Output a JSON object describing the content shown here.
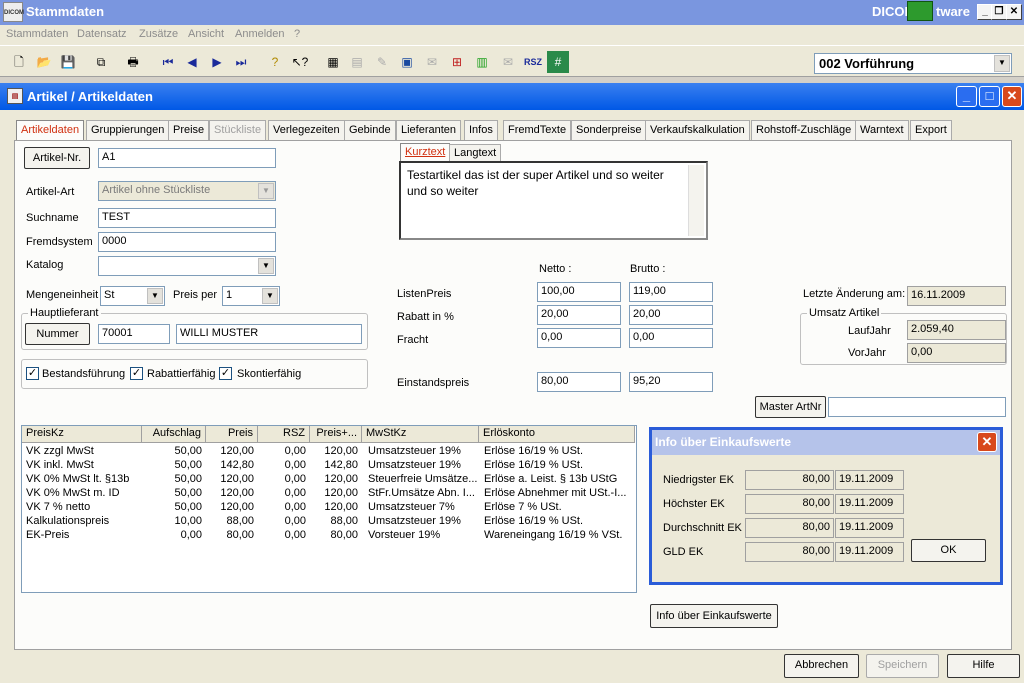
{
  "app": {
    "title": "Stammdaten",
    "brand": "DICOM",
    "brand_tail": "tware",
    "icon_text": "DICOM"
  },
  "menu": [
    "Stammdaten",
    "Datensatz",
    "Zusätze",
    "Ansicht",
    "Anmelden",
    "?"
  ],
  "toolbar": {
    "company_select": "002 Vorführung",
    "rsz_label": "RSZ"
  },
  "window": {
    "title": "Artikel / Artikeldaten"
  },
  "tabs": [
    "Artikeldaten",
    "Gruppierungen",
    "Preise",
    "Stückliste",
    "Verlegezeiten",
    "Gebinde",
    "Lieferanten",
    "Infos",
    "FremdTexte",
    "Sonderpreise",
    "Verkaufskalkulation",
    "Rohstoff-Zuschläge",
    "Warntext",
    "Export"
  ],
  "form": {
    "artikel_nr_button": "Artikel-Nr.",
    "artikel_nr": "A1",
    "artikel_art_label": "Artikel-Art",
    "artikel_art": "Artikel ohne Stückliste",
    "suchname_label": "Suchname",
    "suchname": "TEST",
    "fremdsystem_label": "Fremdsystem",
    "fremdsystem": "0000",
    "katalog_label": "Katalog",
    "katalog": "",
    "mengeneinheit_label": "Mengeneinheit",
    "mengeneinheit": "St",
    "preis_per_label": "Preis per",
    "preis_per": "1",
    "hauptlieferant_label": "Hauptlieferant",
    "nummer_button": "Nummer",
    "lieferant_nr": "70001",
    "lieferant_name": "WILLI MUSTER",
    "bestand": "Bestandsführung",
    "rabatt": "Rabattierfähig",
    "skonto": "Skontierfähig"
  },
  "text_tabs": {
    "kurz": "Kurztext",
    "lang": "Langtext",
    "content": "Testartikel  das ist der super Artikel und so weiter und so weiter"
  },
  "prices": {
    "netto_label": "Netto :",
    "brutto_label": "Brutto :",
    "rows": [
      {
        "label": "ListenPreis",
        "netto": "100,00",
        "brutto": "119,00"
      },
      {
        "label": "Rabatt in %",
        "netto": "20,00",
        "brutto": "20,00"
      },
      {
        "label": "Fracht",
        "netto": "0,00",
        "brutto": "0,00"
      },
      {
        "label": "Einstandspreis",
        "netto": "80,00",
        "brutto": "95,20"
      }
    ]
  },
  "meta": {
    "letzte_label": "Letzte Änderung am:",
    "letzte": "16.11.2009",
    "umsatz_label": "Umsatz Artikel",
    "lauf_label": "LaufJahr",
    "lauf": "2.059,40",
    "vor_label": "VorJahr",
    "vor": "0,00",
    "master_button": "Master ArtNr",
    "master": ""
  },
  "table": {
    "headers": [
      "PreisKz",
      "Aufschlag",
      "Preis",
      "RSZ",
      "Preis+...",
      "MwStKz",
      "Erlöskonto"
    ],
    "rows": [
      [
        "VK zzgl MwSt",
        "50,00",
        "120,00",
        "0,00",
        "120,00",
        "Umsatzsteuer 19%",
        "Erlöse 16/19 % USt."
      ],
      [
        "VK inkl. MwSt",
        "50,00",
        "142,80",
        "0,00",
        "142,80",
        "Umsatzsteuer 19%",
        "Erlöse 16/19 % USt."
      ],
      [
        "VK 0% MwSt lt. §13b",
        "50,00",
        "120,00",
        "0,00",
        "120,00",
        "Steuerfreie Umsätze...",
        "Erlöse a. Leist. § 13b UStG"
      ],
      [
        "VK 0% MwSt m. ID",
        "50,00",
        "120,00",
        "0,00",
        "120,00",
        "StFr.Umsätze Abn. I...",
        "Erlöse Abnehmer mit USt.-I..."
      ],
      [
        "VK 7 % netto",
        "50,00",
        "120,00",
        "0,00",
        "120,00",
        "Umsatzsteuer 7%",
        "Erlöse   7 % USt."
      ],
      [
        "Kalkulationspreis",
        "10,00",
        "88,00",
        "0,00",
        "88,00",
        "Umsatzsteuer 19%",
        "Erlöse 16/19 % USt."
      ],
      [
        "EK-Preis",
        "0,00",
        "80,00",
        "0,00",
        "80,00",
        "Vorsteuer 19%",
        "Wareneingang 16/19 % VSt."
      ]
    ]
  },
  "dialog": {
    "title": "Info über Einkaufswerte",
    "rows": [
      {
        "label": "Niedrigster EK",
        "value": "80,00",
        "date": "19.11.2009"
      },
      {
        "label": "Höchster EK",
        "value": "80,00",
        "date": "19.11.2009"
      },
      {
        "label": "Durchschnitt EK",
        "value": "80,00",
        "date": "19.11.2009"
      },
      {
        "label": "GLD  EK",
        "value": "80,00",
        "date": "19.11.2009"
      }
    ],
    "ok": "OK"
  },
  "info_button": "Info über Einkaufswerte",
  "footer": {
    "abbrechen": "Abbrechen",
    "speichern": "Speichern",
    "hilfe": "Hilfe"
  }
}
